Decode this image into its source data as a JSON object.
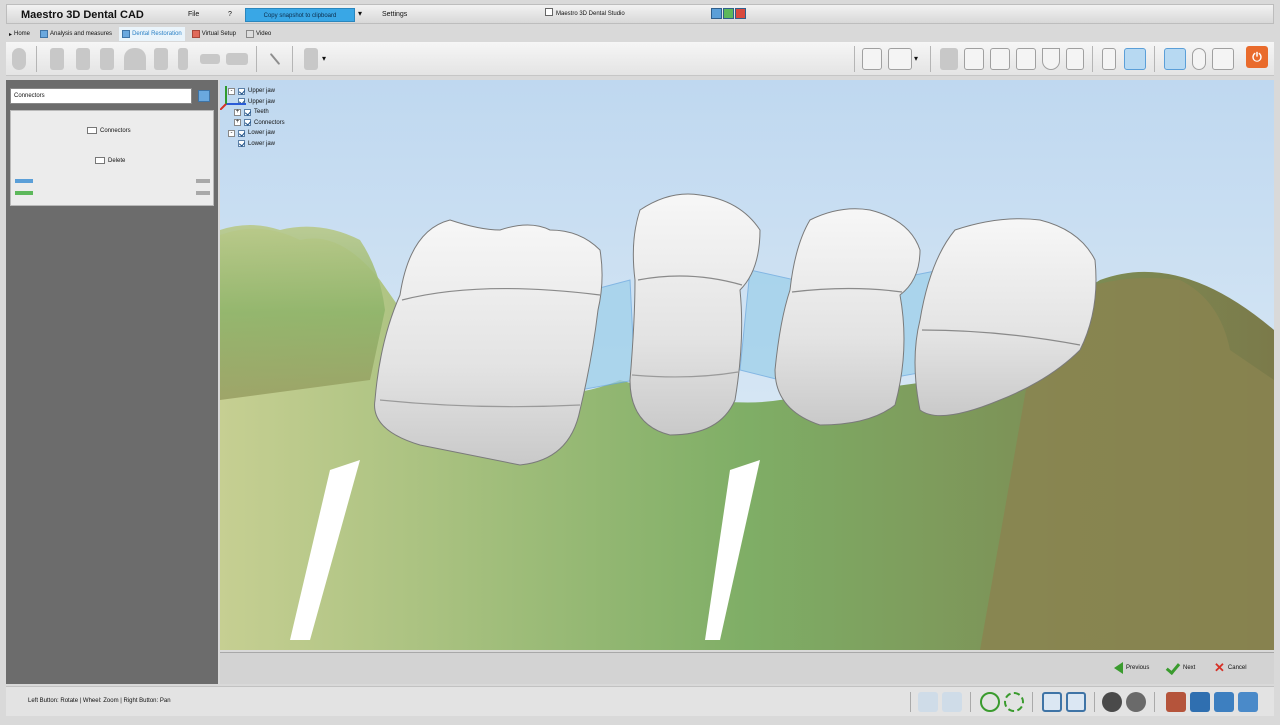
{
  "titlebar": {
    "app_title": "Maestro 3D Dental CAD",
    "menu_file": "File",
    "menu_help": "?",
    "snapshot_button": "Copy snapshot to clipboard",
    "menu_settings": "Settings",
    "window_title": "Maestro 3D Dental Studio"
  },
  "tabs": [
    {
      "label": "Home",
      "icon": "home-icon",
      "active": false
    },
    {
      "label": "Analysis and measures",
      "icon": "ruler-icon",
      "active": false
    },
    {
      "label": "Dental Restoration",
      "icon": "tooth-icon",
      "active": true
    },
    {
      "label": "Virtual Setup",
      "icon": "setup-icon",
      "active": false
    },
    {
      "label": "Video",
      "icon": "video-icon",
      "active": false
    }
  ],
  "left_panel": {
    "search_value": "Connectors",
    "connectors_label": "Connectors",
    "delete_label": "Delete"
  },
  "tree": [
    {
      "label": "Upper jaw",
      "level": 0,
      "expander": "-"
    },
    {
      "label": "Upper jaw",
      "level": 1,
      "expander": ""
    },
    {
      "label": "Teeth",
      "level": 1,
      "expander": "+"
    },
    {
      "label": "Connectors",
      "level": 1,
      "expander": "+"
    },
    {
      "label": "Lower jaw",
      "level": 0,
      "expander": "-"
    },
    {
      "label": "Lower jaw",
      "level": 1,
      "expander": ""
    }
  ],
  "nav": {
    "previous": "Previous",
    "next": "Next",
    "cancel": "Cancel"
  },
  "status": {
    "hint": "Left Button: Rotate | Wheel: Zoom | Right Button: Pan"
  },
  "colors": {
    "accent_blue": "#39a7e6",
    "power_orange": "#e96b2c",
    "gum_green": "#8fb46a",
    "tooth_white": "#f1f1f1",
    "connector_blue": "#9ed0ea"
  }
}
